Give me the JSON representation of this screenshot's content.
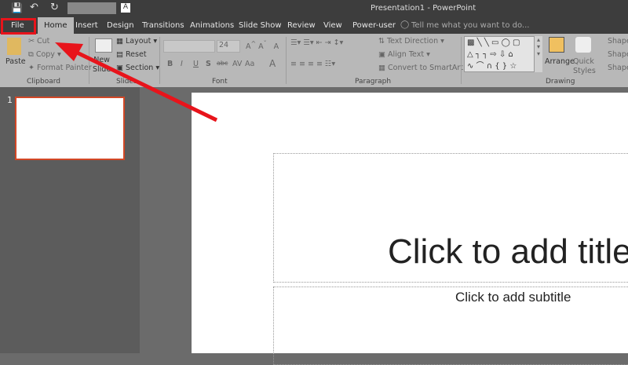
{
  "window": {
    "title": "Presentation1 - PowerPoint"
  },
  "qat": {
    "font_color_letter": "A"
  },
  "tabs": [
    "File",
    "Home",
    "Insert",
    "Design",
    "Transitions",
    "Animations",
    "Slide Show",
    "Review",
    "View",
    "Power-user"
  ],
  "tell_me": "Tell me what you want to do...",
  "clipboard": {
    "paste": "Paste",
    "cut": "Cut",
    "copy": "Copy",
    "format_painter": "Format Painter",
    "label": "Clipboard"
  },
  "slides": {
    "new_slide_1": "New",
    "new_slide_2": "Slide",
    "layout": "Layout",
    "reset": "Reset",
    "section": "Section",
    "label": "Slides"
  },
  "font": {
    "size": "24",
    "bold": "B",
    "italic": "I",
    "underline": "U",
    "shadow": "S",
    "strike": "abc",
    "spacing": "AV",
    "case": "Aa",
    "color": "A",
    "label": "Font"
  },
  "paragraph": {
    "text_direction": "Text Direction",
    "align_text": "Align Text",
    "smartart": "Convert to SmartArt",
    "label": "Paragraph"
  },
  "drawing": {
    "arrange": "Arrange",
    "quick_1": "Quick",
    "quick_2": "Styles",
    "shape1": "Shape",
    "shape2": "Shape",
    "shape3": "Shape",
    "label": "Drawing"
  },
  "thumbnails": [
    {
      "number": "1"
    }
  ],
  "slide": {
    "title_placeholder": "Click to add title",
    "subtitle_placeholder": "Click to add subtitle"
  },
  "colors": {
    "annotation": "#e8141b",
    "thumb_border": "#d24726"
  }
}
